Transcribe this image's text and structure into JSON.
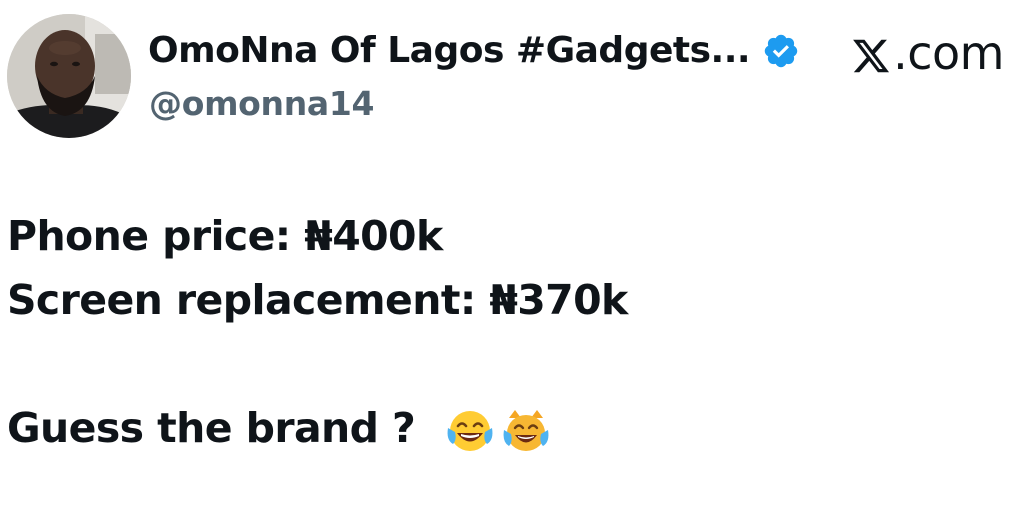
{
  "author": {
    "display_name": "OmoNna Of Lagos #Gadgets...",
    "handle": "@omonna14",
    "verified": true,
    "verified_color": "#1d9bf0"
  },
  "source": {
    "label": ".com",
    "icon": "x-logo-icon"
  },
  "tweet": {
    "line1": "Phone price: ₦400k",
    "line2": "Screen replacement: ₦370k",
    "line3": "Guess the brand ?",
    "emojis": [
      "face-with-tears-of-joy-icon",
      "cat-with-tears-of-joy-icon"
    ]
  },
  "colors": {
    "text": "#0f1419",
    "handle": "#536471",
    "background": "#ffffff"
  }
}
